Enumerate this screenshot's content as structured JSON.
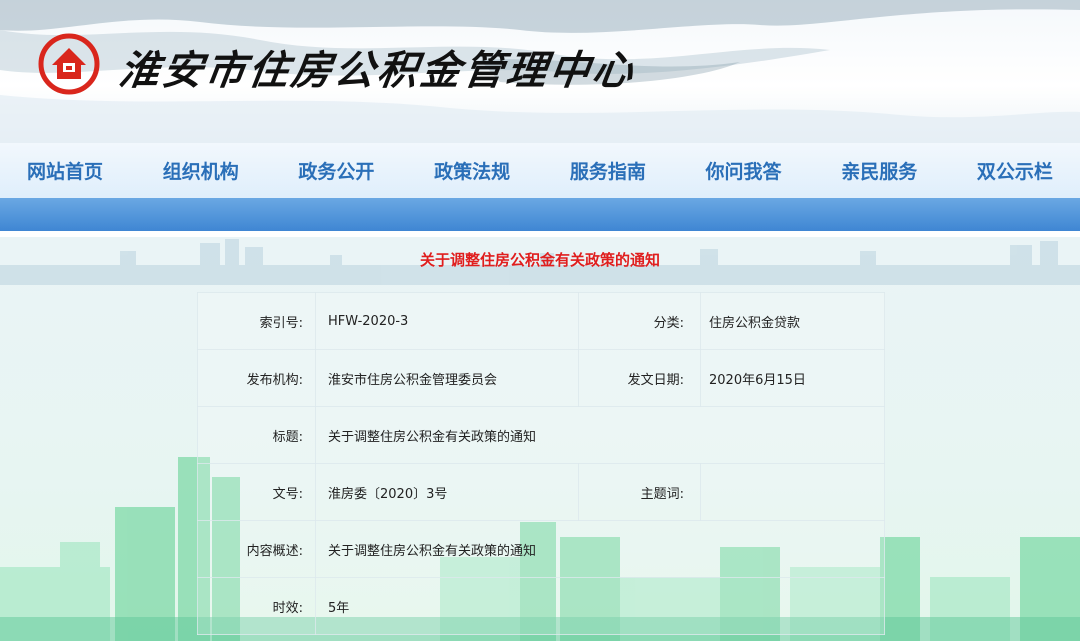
{
  "header": {
    "logo_icon": "house-seal-icon",
    "site_title": "淮安市住房公积金管理中心",
    "brand_color": "#d9261c"
  },
  "nav": {
    "items": [
      "网站首页",
      "组织机构",
      "政务公开",
      "政策法规",
      "服务指南",
      "你问我答",
      "亲民服务",
      "双公示栏"
    ],
    "color": "#2a6fb8"
  },
  "notice": {
    "title": "关于调整住房公积金有关政策的通知",
    "title_color": "#e01e1e"
  },
  "info": {
    "index_label": "索引号:",
    "index_value": "HFW-2020-3",
    "category_label": "分类:",
    "category_value": "住房公积金贷款",
    "publisher_label": "发布机构:",
    "publisher_value": "淮安市住房公积金管理委员会",
    "date_label": "发文日期:",
    "date_value": "2020年6月15日",
    "subject_label": "标题:",
    "subject_value": "关于调整住房公积金有关政策的通知",
    "docno_label": "文号:",
    "docno_value": "淮房委〔2020〕3号",
    "keyword_label": "主题词:",
    "keyword_value": "",
    "summary_label": "内容概述:",
    "summary_value": "关于调整住房公积金有关政策的通知",
    "validity_label": "时效:",
    "validity_value": "5年"
  }
}
